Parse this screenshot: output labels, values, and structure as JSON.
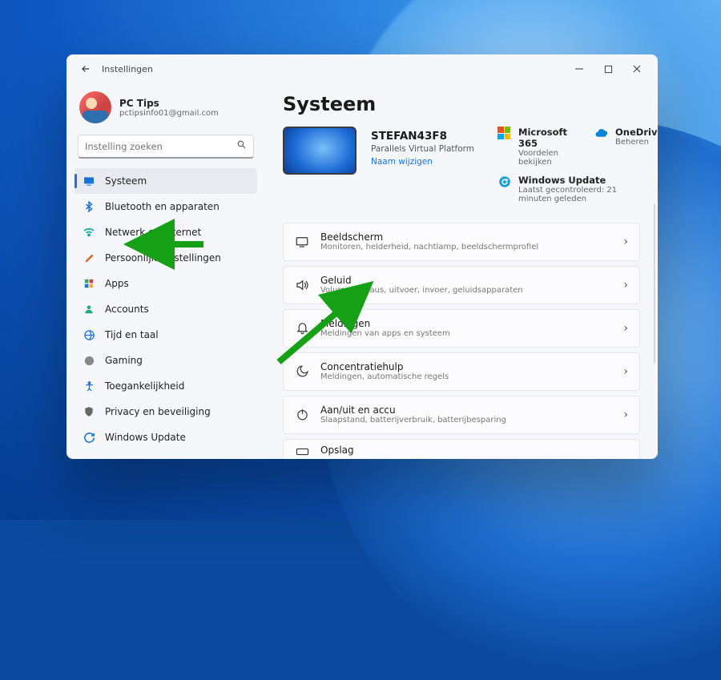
{
  "titlebar": {
    "app_name": "Instellingen"
  },
  "user": {
    "display_name": "PC Tips",
    "email": "pctipsinfo01@gmail.com"
  },
  "search": {
    "placeholder": "Instelling zoeken"
  },
  "sidebar": {
    "items": [
      {
        "label": "Systeem",
        "icon": "system",
        "selected": true
      },
      {
        "label": "Bluetooth en apparaten",
        "icon": "bluetooth"
      },
      {
        "label": "Netwerk en internet",
        "icon": "wifi"
      },
      {
        "label": "Persoonlijke instellingen",
        "icon": "personalize"
      },
      {
        "label": "Apps",
        "icon": "apps"
      },
      {
        "label": "Accounts",
        "icon": "account"
      },
      {
        "label": "Tijd en taal",
        "icon": "time"
      },
      {
        "label": "Gaming",
        "icon": "gaming"
      },
      {
        "label": "Toegankelijkheid",
        "icon": "accessibility"
      },
      {
        "label": "Privacy en beveiliging",
        "icon": "privacy"
      },
      {
        "label": "Windows Update",
        "icon": "update"
      }
    ]
  },
  "page": {
    "title": "Systeem",
    "pc": {
      "name": "STEFAN43F8",
      "platform": "Parallels Virtual Platform",
      "rename": "Naam wijzigen"
    },
    "tiles": {
      "m365": {
        "title": "Microsoft 365",
        "sub": "Voordelen bekijken"
      },
      "onedrive": {
        "title": "OneDrive",
        "sub": "Beheren"
      },
      "update": {
        "title": "Windows Update",
        "sub": "Laatst gecontroleerd: 21 minuten geleden"
      }
    },
    "rows": [
      {
        "title": "Beeldscherm",
        "sub": "Monitoren, helderheid, nachtlamp, beeldschermprofiel",
        "icon": "display"
      },
      {
        "title": "Geluid",
        "sub": "Volume niveaus, uitvoer, invoer, geluidsapparaten",
        "icon": "sound"
      },
      {
        "title": "Meldingen",
        "sub": "Meldingen van apps en systeem",
        "icon": "bell"
      },
      {
        "title": "Concentratiehulp",
        "sub": "Meldingen, automatische regels",
        "icon": "moon"
      },
      {
        "title": "Aan/uit en accu",
        "sub": "Slaapstand, batterijverbruik, batterijbesparing",
        "icon": "power"
      },
      {
        "title": "Opslag",
        "sub": "",
        "icon": "storage"
      }
    ]
  }
}
